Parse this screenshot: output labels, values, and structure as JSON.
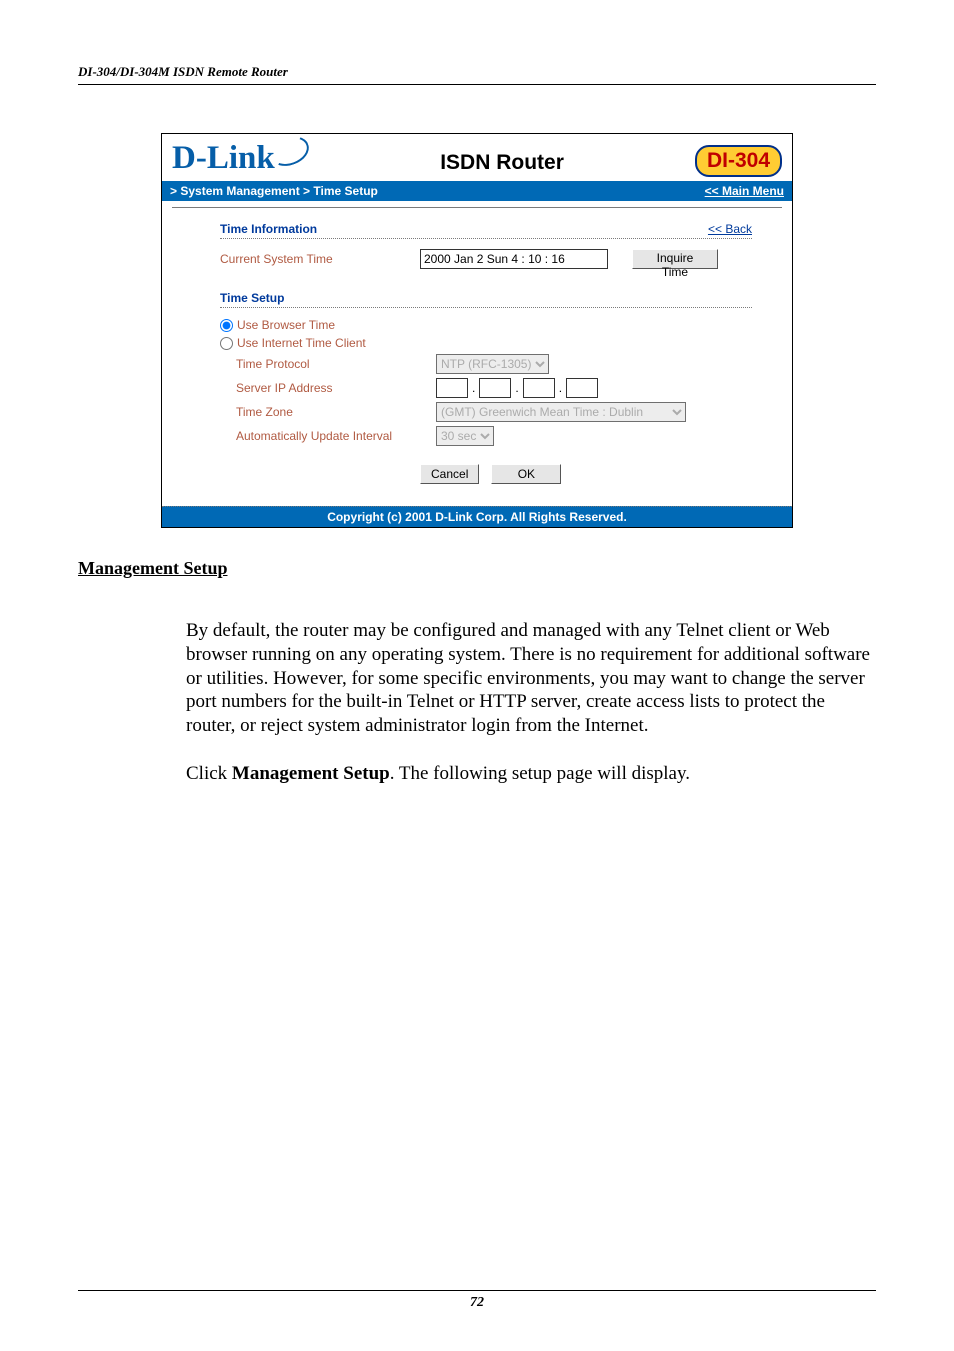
{
  "running_header": "DI-304/DI-304M ISDN Remote Router",
  "page_number": "72",
  "shot": {
    "logo_text": "D-Link",
    "header_title": "ISDN Router",
    "model": "DI-304",
    "breadcrumb": "> System Management > Time Setup",
    "main_menu": "<< Main Menu",
    "time_info_title": "Time Information",
    "back_link": "<< Back",
    "current_time_label": "Current System Time",
    "current_time_value": "2000 Jan 2 Sun 4 : 10 : 16",
    "inquire_btn": "Inquire Time",
    "time_setup_title": "Time Setup",
    "radio_browser": "Use Browser Time",
    "radio_internet": "Use Internet Time Client",
    "proto_label": "Time Protocol",
    "proto_value": "NTP (RFC-1305)",
    "ip_label": "Server IP Address",
    "tz_label": "Time Zone",
    "tz_value": "(GMT) Greenwich Mean Time : Dublin",
    "interval_label": "Automatically Update Interval",
    "interval_value": "30 sec",
    "cancel": "Cancel",
    "ok": "OK",
    "copyright": "Copyright (c) 2001 D-Link Corp. All Rights Reserved."
  },
  "doc": {
    "heading": "Management Setup",
    "para1": "By default, the router may be configured and managed with any Telnet client or Web browser running on any operating system. There is no requirement for additional software or utilities. However, for some specific environments, you may want to change the server port numbers for the built-in Telnet or HTTP server, create access lists to protect the router, or reject system administrator login from the Internet.",
    "para2a": "Click ",
    "para2b": "Management Setup",
    "para2c": ". The following setup page will display."
  }
}
